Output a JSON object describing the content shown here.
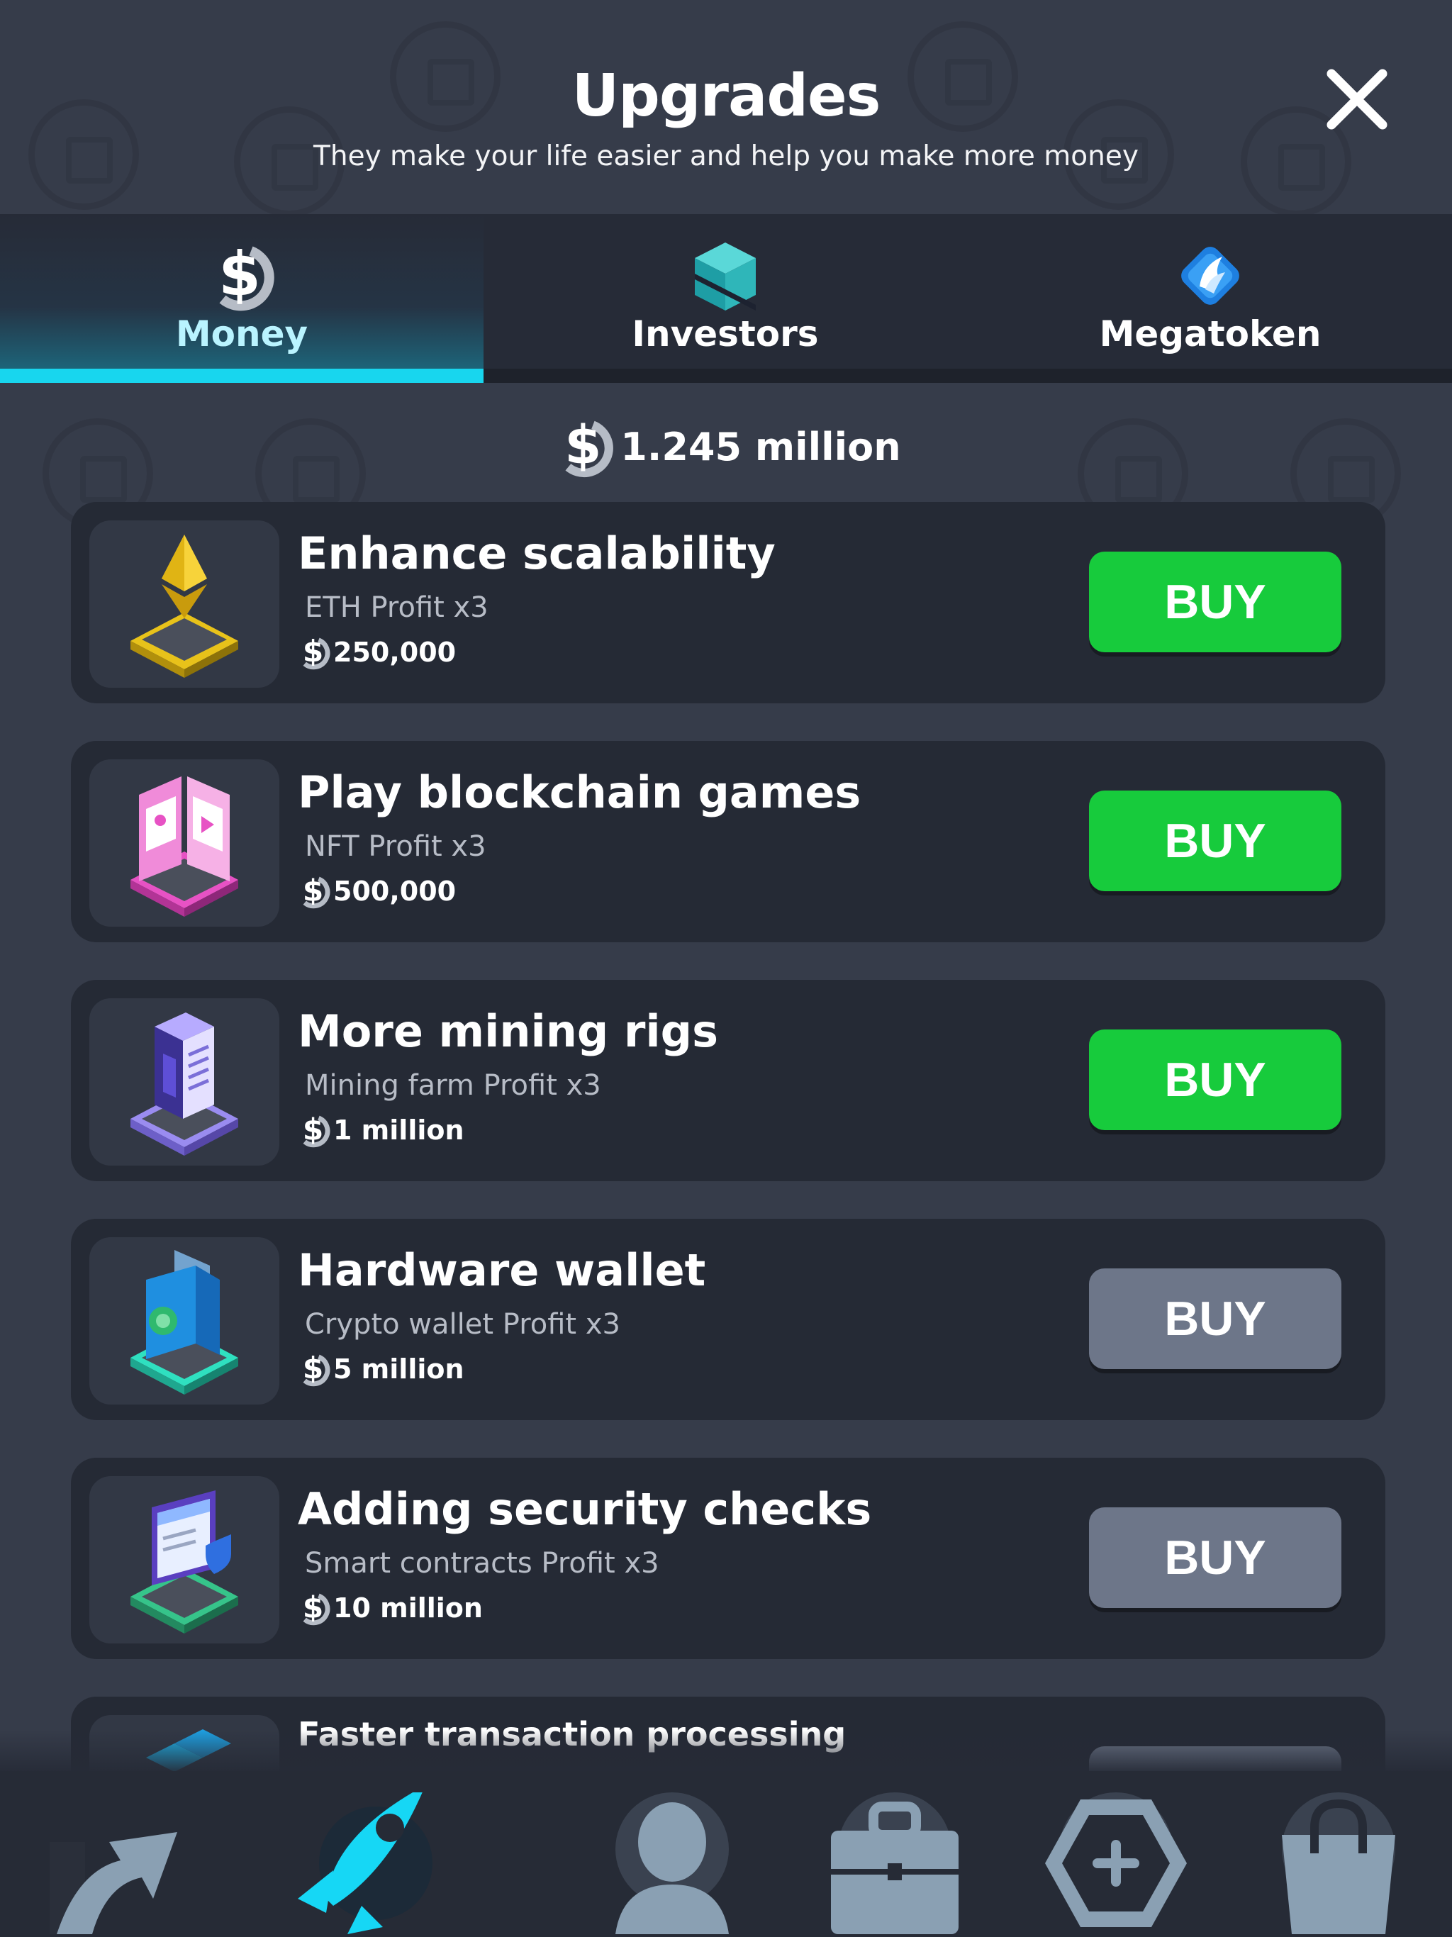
{
  "header": {
    "title": "Upgrades",
    "subtitle": "They make your life easier and help you make more money"
  },
  "tabs": [
    {
      "label": "Money",
      "icon": "dollar-coin-icon",
      "active": true
    },
    {
      "label": "Investors",
      "icon": "cube-icon",
      "active": false
    },
    {
      "label": "Megatoken",
      "icon": "megatoken-icon",
      "active": false
    }
  ],
  "balance": {
    "amount": "1.245 million",
    "icon": "dollar-coin-icon"
  },
  "upgrades": [
    {
      "title": "Enhance scalability",
      "subtitle": "ETH Profit x3",
      "price": "250,000",
      "button": "BUY",
      "enabled": true,
      "icon": "ethereum-icon"
    },
    {
      "title": "Play blockchain games",
      "subtitle": "NFT Profit x3",
      "price": "500,000",
      "button": "BUY",
      "enabled": true,
      "icon": "nft-book-icon"
    },
    {
      "title": "More mining rigs",
      "subtitle": "Mining farm Profit x3",
      "price": "1 million",
      "button": "BUY",
      "enabled": true,
      "icon": "mining-rig-icon"
    },
    {
      "title": "Hardware wallet",
      "subtitle": "Crypto wallet Profit x3",
      "price": "5 million",
      "button": "BUY",
      "enabled": false,
      "icon": "wallet-icon"
    },
    {
      "title": "Adding security checks",
      "subtitle": "Smart contracts Profit x3",
      "price": "10 million",
      "button": "BUY",
      "enabled": false,
      "icon": "security-document-icon"
    },
    {
      "title": "Faster transaction processing",
      "icon": "blocks-icon"
    }
  ],
  "nav": [
    {
      "name": "upgrade",
      "icon": "arrow-up-icon"
    },
    {
      "name": "boost",
      "icon": "rocket-icon",
      "active": true
    },
    {
      "name": "profile",
      "icon": "person-icon"
    },
    {
      "name": "business",
      "icon": "briefcase-icon"
    },
    {
      "name": "add",
      "icon": "hexagon-plus-icon"
    },
    {
      "name": "shop",
      "icon": "shopping-bag-icon"
    }
  ],
  "colors": {
    "background": "#363c4a",
    "panel": "#252a35",
    "accent": "#18d6ee",
    "buy_enabled": "#17cb3c",
    "buy_disabled": "#6d7689"
  }
}
